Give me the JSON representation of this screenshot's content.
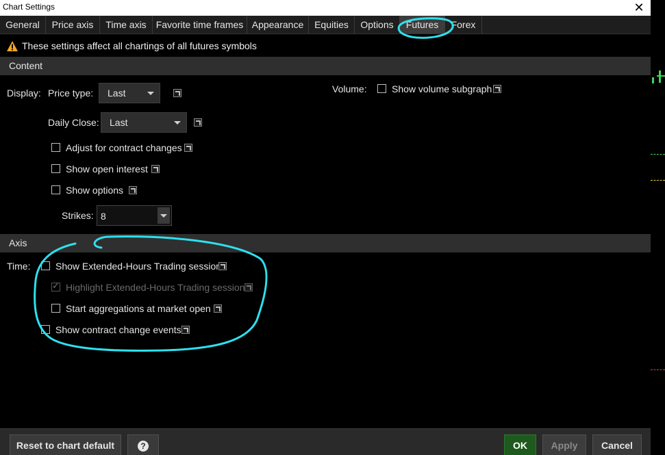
{
  "window": {
    "title": "Chart Settings",
    "close_glyph": "✕"
  },
  "tabs": [
    {
      "label": "General"
    },
    {
      "label": "Price axis"
    },
    {
      "label": "Time axis"
    },
    {
      "label": "Favorite time frames"
    },
    {
      "label": "Appearance"
    },
    {
      "label": "Equities"
    },
    {
      "label": "Options"
    },
    {
      "label": "Futures"
    },
    {
      "label": "Forex"
    }
  ],
  "active_tab": "Futures",
  "warning": {
    "icon": "warning-icon",
    "text": "These settings affect all chartings of all futures symbols"
  },
  "content": {
    "header": "Content",
    "display_label": "Display:",
    "price_type_label": "Price type:",
    "price_type_value": "Last",
    "daily_close_label": "Daily Close:",
    "daily_close_value": "Last",
    "adjust_contract_label": "Adjust for contract changes",
    "show_open_interest_label": "Show open interest",
    "show_options_label": "Show options",
    "strikes_label": "Strikes:",
    "strikes_value": "8",
    "volume_label": "Volume:",
    "show_volume_label": "Show volume subgraph"
  },
  "axis": {
    "header": "Axis",
    "time_label": "Time:",
    "show_eth_label": "Show Extended-Hours Trading session",
    "highlight_eth_label": "Highlight Extended-Hours Trading session",
    "start_aggregations_label": "Start aggregations at market open",
    "show_contract_change_label": "Show contract change events"
  },
  "footer": {
    "reset_label": "Reset to chart default",
    "help_glyph": "?",
    "ok_label": "OK",
    "apply_label": "Apply",
    "cancel_label": "Cancel"
  },
  "colors": {
    "background": "#000000",
    "section_bar": "#2f2f2f",
    "annotation": "#2ee0ee",
    "ok_green": "#1e5a1e",
    "warning_orange": "#f5a623"
  }
}
